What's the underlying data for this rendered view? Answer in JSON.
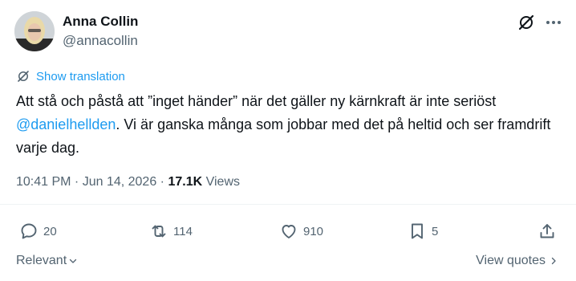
{
  "author": {
    "display_name": "Anna Collin",
    "handle": "@annacollin"
  },
  "translation_label": "Show translation",
  "tweet": {
    "text_before": "Att stå och påstå att ”inget händer” när det gäller ny kärnkraft är inte seriöst ",
    "mention": "@danielhellden",
    "text_after": ". Vi är ganska många som jobbar med det på heltid och ser framdrift varje dag."
  },
  "meta": {
    "time": "10:41 PM",
    "separator": " · ",
    "date": "Jun 14, 2026",
    "separator2": " · ",
    "views_count": "17.1K",
    "views_label": " Views"
  },
  "actions": {
    "replies": "20",
    "reposts": "114",
    "likes": "910",
    "bookmarks": "5"
  },
  "footer": {
    "sort_label": "Relevant",
    "view_quotes_label": "View quotes"
  },
  "colors": {
    "link": "#1d9bf0",
    "secondary_text": "#536471",
    "primary_text": "#0f1419"
  },
  "icons": [
    "grok-icon",
    "more-icon",
    "translate-icon",
    "reply-icon",
    "repost-icon",
    "like-icon",
    "bookmark-icon",
    "share-icon",
    "chevron-down-icon",
    "chevron-right-icon"
  ]
}
